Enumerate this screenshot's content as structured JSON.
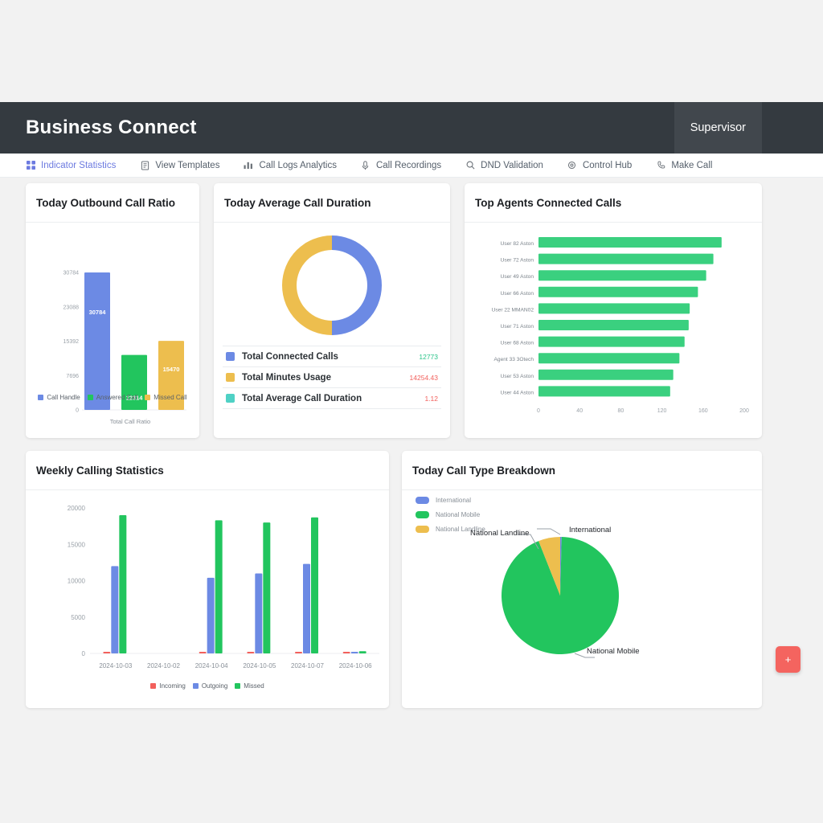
{
  "header": {
    "brand": "Business Connect",
    "user_role": "Supervisor"
  },
  "nav": {
    "items": [
      {
        "label": "Indicator Statistics",
        "icon": "grid-icon",
        "active": true
      },
      {
        "label": "View Templates",
        "icon": "document-icon",
        "active": false
      },
      {
        "label": "Call Logs Analytics",
        "icon": "chart-icon",
        "active": false
      },
      {
        "label": "Call Recordings",
        "icon": "microphone-icon",
        "active": false
      },
      {
        "label": "DND Validation",
        "icon": "search-icon",
        "active": false
      },
      {
        "label": "Control Hub",
        "icon": "gear-icon",
        "active": false
      },
      {
        "label": "Make Call",
        "icon": "phone-icon",
        "active": false
      }
    ]
  },
  "cards": {
    "outbound": {
      "title": "Today Outbound Call Ratio"
    },
    "duration": {
      "title": "Today Average Call Duration"
    },
    "agents": {
      "title": "Top Agents Connected Calls"
    },
    "weekly": {
      "title": "Weekly Calling Statistics"
    },
    "types": {
      "title": "Today Call Type Breakdown"
    }
  },
  "duration_summary": {
    "rows": [
      {
        "label": "Total Connected Calls",
        "value": "12773",
        "swatch": "#6c8ae4",
        "value_color": "#2bc48a"
      },
      {
        "label": "Total Minutes Usage",
        "value": "14254.43",
        "swatch": "#edbe4e",
        "value_color": "#f2605c"
      },
      {
        "label": "Total Average Call Duration",
        "value": "1.12",
        "swatch": "#4fd1c5",
        "value_color": "#f2605c"
      }
    ]
  },
  "colors": {
    "blue": "#6c8ae4",
    "green": "#22c55e",
    "green_soft": "#3ad07f",
    "yellow": "#edbe4e",
    "red": "#f2605c",
    "fab": "#f4645f",
    "header_bg": "#343a40"
  },
  "fab": {
    "label": "+"
  },
  "chart_data": [
    {
      "id": "outbound",
      "type": "bar",
      "title": "Today Outbound Call Ratio",
      "categories": [
        "Call Handle",
        "Answered Call",
        "Missed Call"
      ],
      "values": [
        30784,
        12314,
        15470
      ],
      "bar_labels": [
        "30784",
        "12314",
        "15470"
      ],
      "colors": [
        "#6c8ae4",
        "#22c55e",
        "#edbe4e"
      ],
      "xlabel": "Total Call Ratio",
      "ylabel": "",
      "ytick_labels": [
        "30784",
        "23088",
        "15392",
        "7696",
        "0"
      ],
      "ytick_values": [
        30784,
        23088,
        15392,
        7696,
        0
      ],
      "ylim": [
        0,
        30784
      ],
      "grid": false,
      "legend_position": "bottom"
    },
    {
      "id": "duration",
      "type": "pie",
      "title": "Today Average Call Duration",
      "donut": true,
      "labels": [
        "Total Connected Calls",
        "Total Minutes Usage"
      ],
      "values": [
        50,
        50
      ],
      "colors": [
        "#6c8ae4",
        "#edbe4e"
      ],
      "legend_position": "bottom"
    },
    {
      "id": "agents",
      "type": "bar",
      "orientation": "horizontal",
      "title": "Top Agents Connected Calls",
      "categories": [
        "User 82 Aston",
        "User 72 Aston",
        "User 49 Aston",
        "User 66 Aston",
        "User 22 MMAN02",
        "User 71 Aston",
        "User 68 Aston",
        "Agent 33 3Otech",
        "User 53 Aston",
        "User 44 Aston"
      ],
      "values": [
        178,
        170,
        163,
        155,
        147,
        146,
        142,
        137,
        131,
        128
      ],
      "color": "#3ad07f",
      "xlim": [
        0,
        200
      ],
      "xtick_labels": [
        "0",
        "40",
        "80",
        "120",
        "160",
        "200"
      ],
      "xtick_values": [
        0,
        40,
        80,
        120,
        160,
        200
      ],
      "grid": false
    },
    {
      "id": "weekly",
      "type": "bar",
      "title": "Weekly Calling Statistics",
      "categories": [
        "2024-10-03",
        "2024-10-02",
        "2024-10-04",
        "2024-10-05",
        "2024-10-07",
        "2024-10-06"
      ],
      "series": [
        {
          "name": "Incoming",
          "color": "#f2605c",
          "values": [
            120,
            0,
            120,
            80,
            130,
            60
          ]
        },
        {
          "name": "Outgoing",
          "color": "#6c8ae4",
          "values": [
            12000,
            0,
            10400,
            11000,
            12300,
            150
          ]
        },
        {
          "name": "Missed",
          "color": "#22c55e",
          "values": [
            19000,
            0,
            18300,
            18000,
            18700,
            300
          ]
        }
      ],
      "ylim": [
        0,
        20000
      ],
      "ytick_labels": [
        "20000",
        "15000",
        "10000",
        "5000",
        "0"
      ],
      "ytick_values": [
        20000,
        15000,
        10000,
        5000,
        0
      ],
      "grid": false,
      "legend_position": "bottom"
    },
    {
      "id": "types",
      "type": "pie",
      "title": "Today Call Type Breakdown",
      "labels": [
        "International",
        "National Mobile",
        "National Landline"
      ],
      "values": [
        0.4,
        93.6,
        6.0
      ],
      "colors": [
        "#6c8ae4",
        "#22c55e",
        "#edbe4e"
      ],
      "annotations": [
        "National Landline",
        "International",
        "National Mobile"
      ],
      "legend_position": "top-left"
    }
  ]
}
